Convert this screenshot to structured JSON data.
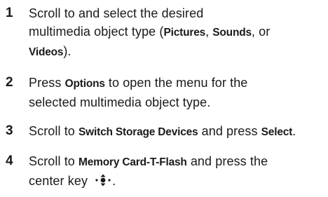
{
  "steps": [
    {
      "number": "1",
      "parts": {
        "t1": "Scroll to and select the desired",
        "t2": "multimedia object type (",
        "k1": "Pictures",
        "t3": ", ",
        "k2": "Sounds",
        "t4": ", or",
        "k3": "Videos",
        "t5": ")."
      }
    },
    {
      "number": "2",
      "parts": {
        "t1": "Press ",
        "k1": "Options",
        "t2": " to open the menu for the",
        "t3": "selected multimedia object type."
      }
    },
    {
      "number": "3",
      "parts": {
        "t1": "Scroll to ",
        "k1": "Switch Storage Devices",
        "t2": " and press ",
        "k2": "Select",
        "t3": "."
      }
    },
    {
      "number": "4",
      "parts": {
        "t1": "Scroll to ",
        "k1": "Memory Card-T-Flash",
        "t2": " and press the",
        "t3": "center key ",
        "icon": "center-nav-key-icon",
        "t4": "."
      }
    }
  ]
}
